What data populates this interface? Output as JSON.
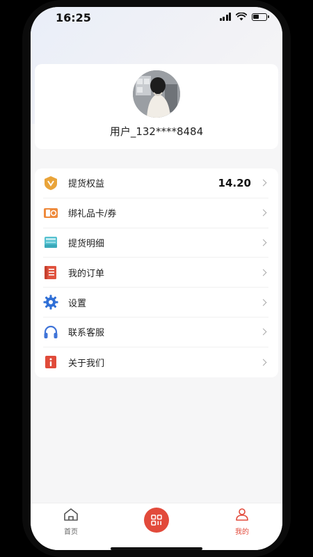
{
  "status_bar": {
    "time": "16:25"
  },
  "profile": {
    "username": "用户_132****8484"
  },
  "menu": {
    "items": [
      {
        "label": "提货权益",
        "value": "14.20",
        "icon": "gold-badge-icon"
      },
      {
        "label": "绑礼品卡/券",
        "value": "",
        "icon": "gift-card-icon"
      },
      {
        "label": "提货明细",
        "value": "",
        "icon": "inbox-tray-icon"
      },
      {
        "label": "我的订单",
        "value": "",
        "icon": "order-list-icon"
      },
      {
        "label": "设置",
        "value": "",
        "icon": "gear-icon"
      },
      {
        "label": "联系客服",
        "value": "",
        "icon": "headset-icon"
      },
      {
        "label": "关于我们",
        "value": "",
        "icon": "info-icon"
      }
    ]
  },
  "tab_bar": {
    "home_label": "首页",
    "mine_label": "我的",
    "active_color": "#e24a3b",
    "inactive_color": "#666666"
  }
}
